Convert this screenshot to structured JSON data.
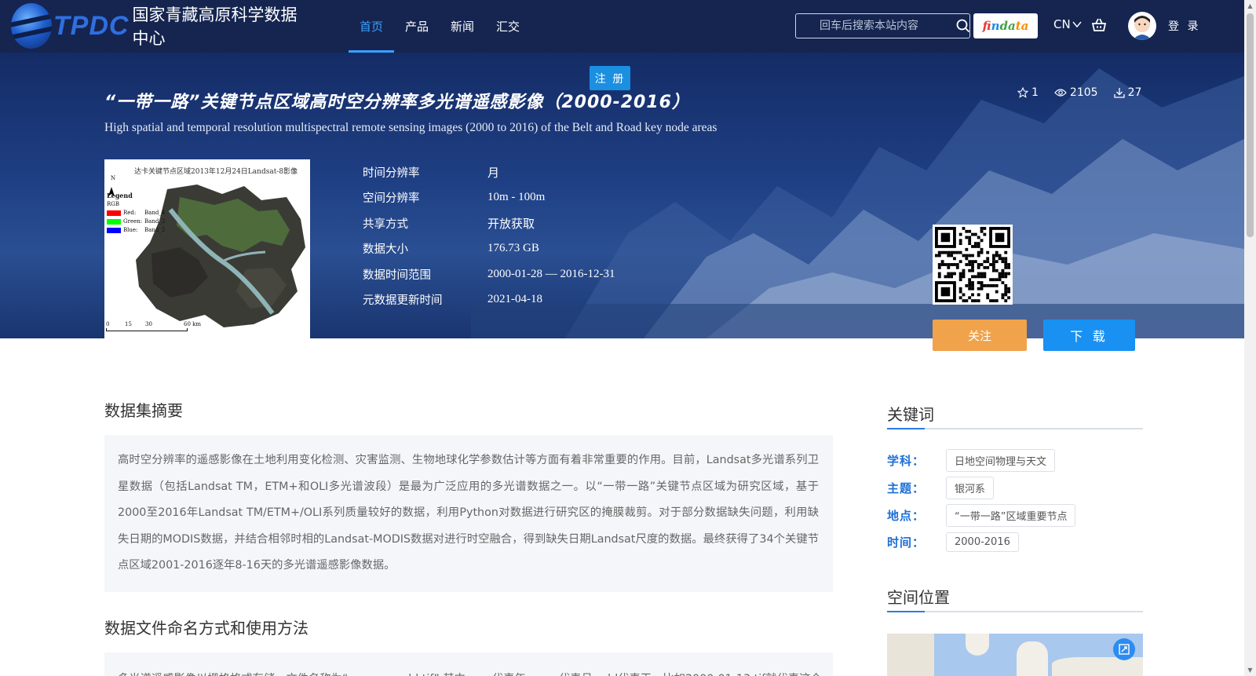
{
  "header": {
    "logo_abbr": "TPDC",
    "logo_name": "国家青藏高原科学数据中心",
    "nav": [
      {
        "label": "首页",
        "active": true
      },
      {
        "label": "产品",
        "active": false
      },
      {
        "label": "新闻",
        "active": false
      },
      {
        "label": "汇交",
        "active": false
      }
    ],
    "search_placeholder": "回车后搜索本站内容",
    "findata": [
      "fi",
      "n",
      "da",
      "ta"
    ],
    "lang": "CN",
    "login": "登 录"
  },
  "hero": {
    "register": "注 册",
    "title_cn": "“一带一路”关键节点区域高时空分辨率多光谱遥感影像（2000-2016）",
    "title_en": "High spatial and temporal resolution multispectral remote sensing images (2000 to 2016) of the Belt and Road key node areas",
    "stats": {
      "stars": "1",
      "views": "2105",
      "downloads": "27"
    },
    "thumbnail": {
      "caption": "达卡关键节点区域2013年12月24日Landsat-8影像",
      "north": "N",
      "legend_title": "Legend",
      "legend_sub": "RGB",
      "legend": [
        {
          "channel": "Red:",
          "band": "Band_4",
          "color": "#ff0000"
        },
        {
          "channel": "Green:",
          "band": "Band_3",
          "color": "#00ff00"
        },
        {
          "channel": "Blue:",
          "band": "Band_2",
          "color": "#0000ff"
        }
      ],
      "scale": [
        "0",
        "15",
        "30",
        "60 km"
      ]
    },
    "meta": [
      {
        "label": "时间分辨率",
        "value": "月"
      },
      {
        "label": "空间分辨率",
        "value": "10m - 100m"
      },
      {
        "label": "共享方式",
        "value": "开放获取"
      },
      {
        "label": "数据大小",
        "value": "176.73 GB"
      },
      {
        "label": "数据时间范围",
        "value": "2000-01-28 — 2016-12-31"
      },
      {
        "label": "元数据更新时间",
        "value": "2021-04-18"
      }
    ],
    "follow_label": "关注",
    "download_label": "下 载"
  },
  "main": {
    "abstract_title": "数据集摘要",
    "abstract_text": "高时空分辨率的遥感影像在土地利用变化检测、灾害监测、生物地球化学参数估计等方面有着非常重要的作用。目前，Landsat多光谱系列卫星数据（包括Landsat TM，ETM+和OLI多光谱波段）是最为广泛应用的多光谱数据之一。以“一带一路”关键节点区域为研究区域，基于2000至2016年Landsat TM/ETM+/OLI系列质量较好的数据，利用Python对数据进行研究区的掩膜裁剪。对于部分数据缺失问题，利用缺失日期的MODIS数据，并结合相邻时相的Landsat-MODIS数据对进行时空融合，得到缺失日期Landsat尺度的数据。最终获得了34个关键节点区域2001-2016逐年8-16天的多光谱遥感影像数据。",
    "naming_title": "数据文件命名方式和使用方法",
    "naming_text": "多光谱遥感影像以栅格格式存储，文件名称为“yyyy-mm-dd.tif”,其中yyyy代表年，mm代表月，dd代表天，比如2000-01-13.tif就代表这个"
  },
  "sidebar": {
    "keywords_title": "关键词",
    "keywords": [
      {
        "label": "学科：",
        "tag": "日地空间物理与天文"
      },
      {
        "label": "主题：",
        "tag": "银河系"
      },
      {
        "label": "地点：",
        "tag": "“一带一路”区域重要节点"
      },
      {
        "label": "时间：",
        "tag": "2000-2016"
      }
    ],
    "location_title": "空间位置"
  },
  "colors": {
    "header_bg": "#152550",
    "nav_active": "#3aa0ff",
    "follow_btn": "#f0a34b",
    "download_btn": "#1891f2",
    "keyword_label": "#1d6fd6"
  }
}
